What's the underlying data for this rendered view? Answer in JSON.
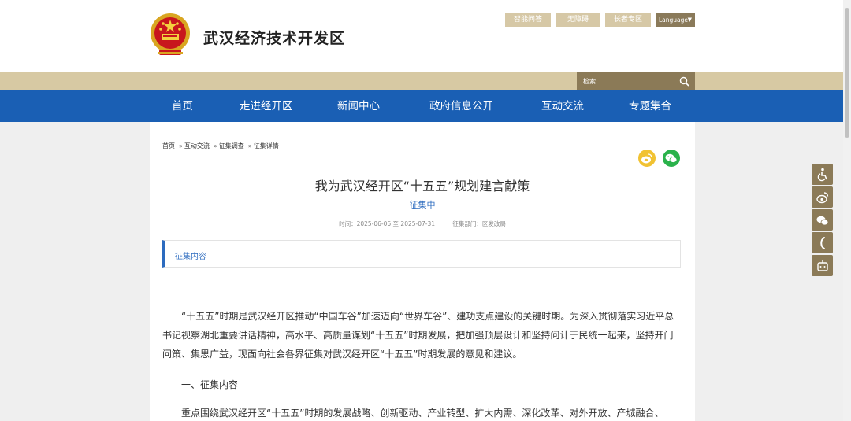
{
  "header": {
    "site_title": "武汉经济技术开发区",
    "top_links": [
      "智能问答",
      "无障碍",
      "长者专区"
    ],
    "language": "Language"
  },
  "search": {
    "placeholder": "检索"
  },
  "nav": {
    "items": [
      "首页",
      "走进经开区",
      "新闻中心",
      "政府信息公开",
      "互动交流",
      "专题集合"
    ]
  },
  "breadcrumb": {
    "items": [
      "首页",
      "互动交流",
      "征集调查",
      "征集详情"
    ],
    "separator": "»"
  },
  "article": {
    "title": "我为武汉经开区“十五五”规划建言献策",
    "status": "征集中",
    "time": "时间：2025-06-06 至 2025-07-31",
    "department": "征集部门：区发改局",
    "section_label": "征集内容",
    "paragraph_1": "“十五五”时期是武汉经开区推动“中国车谷”加速迈向“世界车谷”、建功支点建设的关键时期。为深入贯彻落实习近平总书记视察湖北重要讲话精神，高水平、高质量谋划“十五五”时期发展，把加强顶层设计和坚持问计于民统一起来，坚持开门问策、集思广益，现面向社会各界征集对武汉经开区“十五五”时期发展的意见和建议。",
    "heading_1": "一、征集内容",
    "paragraph_2": "重点围绕武汉经开区“十五五”时期的发展战略、创新驱动、产业转型、扩大内需、深化改革、对外开放、产城融合、"
  },
  "colors": {
    "nav_blue": "#1a5fb4",
    "beige": "#d7c9a3",
    "brown": "#8b7a57",
    "link_blue": "#2c6bbf",
    "weibo_yellow": "#f1c232",
    "wechat_green": "#2ab24b"
  },
  "icons": {
    "share": [
      "weibo-icon",
      "wechat-icon"
    ],
    "float_bar": [
      "accessibility-icon",
      "weibo-icon",
      "wechat-icon",
      "phone-icon",
      "robot-icon"
    ]
  }
}
